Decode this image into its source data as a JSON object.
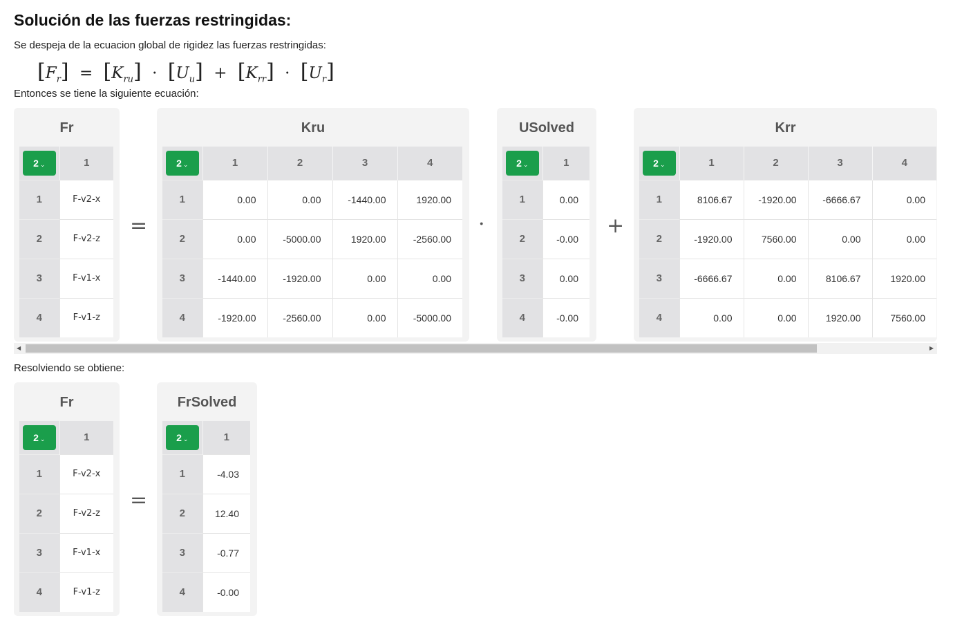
{
  "title": "Solución de las fuerzas restringidas:",
  "intro": "Se despeja de la ecuacion global de rigidez las fuerzas restringidas:",
  "formula": {
    "F": "F",
    "F_sub": "r",
    "K1": "K",
    "K1_sub": "ru",
    "U1": "U",
    "U1_sub": "u",
    "K2": "K",
    "K2_sub": "rr",
    "U2": "U",
    "U2_sub": "r",
    "lbr": "[",
    "rbr": "]",
    "eq": "=",
    "dot": "·",
    "plus": "+"
  },
  "eq_text": "Entonces se tiene la siguiente ecuación:",
  "result_text": "Resolviendo se obtiene:",
  "operators": {
    "equals": "=",
    "dot": "·",
    "plus": "+"
  },
  "dim_button": {
    "label": "2",
    "chevron": "⌄",
    "color": "#1a9e4b"
  },
  "matrices": {
    "fr": {
      "title": "Fr",
      "col_headers": [
        "1"
      ],
      "row_headers": [
        "1",
        "2",
        "3",
        "4"
      ],
      "rows": [
        [
          "F-v2-x"
        ],
        [
          "F-v2-z"
        ],
        [
          "F-v1-x"
        ],
        [
          "F-v1-z"
        ]
      ]
    },
    "kru": {
      "title": "Kru",
      "col_headers": [
        "1",
        "2",
        "3",
        "4"
      ],
      "row_headers": [
        "1",
        "2",
        "3",
        "4"
      ],
      "rows": [
        [
          "0.00",
          "0.00",
          "-1440.00",
          "1920.00"
        ],
        [
          "0.00",
          "-5000.00",
          "1920.00",
          "-2560.00"
        ],
        [
          "-1440.00",
          "-1920.00",
          "0.00",
          "0.00"
        ],
        [
          "-1920.00",
          "-2560.00",
          "0.00",
          "-5000.00"
        ]
      ]
    },
    "usolved": {
      "title": "USolved",
      "col_headers": [
        "1"
      ],
      "row_headers": [
        "1",
        "2",
        "3",
        "4"
      ],
      "rows": [
        [
          "0.00"
        ],
        [
          "-0.00"
        ],
        [
          "0.00"
        ],
        [
          "-0.00"
        ]
      ]
    },
    "krr": {
      "title": "Krr",
      "col_headers": [
        "1",
        "2",
        "3",
        "4"
      ],
      "row_headers": [
        "1",
        "2",
        "3",
        "4"
      ],
      "rows": [
        [
          "8106.67",
          "-1920.00",
          "-6666.67",
          "0.00"
        ],
        [
          "-1920.00",
          "7560.00",
          "0.00",
          "0.00"
        ],
        [
          "-6666.67",
          "0.00",
          "8106.67",
          "1920.00"
        ],
        [
          "0.00",
          "0.00",
          "1920.00",
          "7560.00"
        ]
      ]
    },
    "fr2": {
      "title": "Fr",
      "col_headers": [
        "1"
      ],
      "row_headers": [
        "1",
        "2",
        "3",
        "4"
      ],
      "rows": [
        [
          "F-v2-x"
        ],
        [
          "F-v2-z"
        ],
        [
          "F-v1-x"
        ],
        [
          "F-v1-z"
        ]
      ]
    },
    "frsolved": {
      "title": "FrSolved",
      "col_headers": [
        "1"
      ],
      "row_headers": [
        "1",
        "2",
        "3",
        "4"
      ],
      "rows": [
        [
          "-4.03"
        ],
        [
          "12.40"
        ],
        [
          "-0.77"
        ],
        [
          "-0.00"
        ]
      ]
    }
  },
  "scrollbar": {
    "left_arrow": "◀",
    "right_arrow": "▶"
  }
}
